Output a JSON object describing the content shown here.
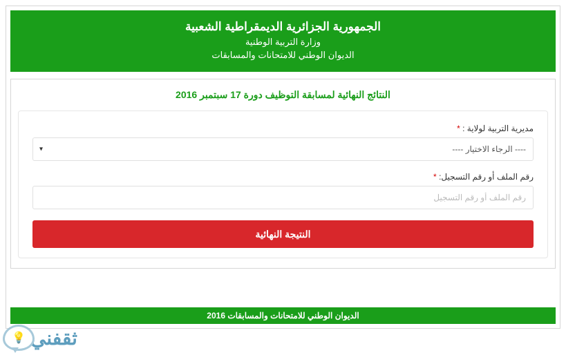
{
  "header": {
    "line1": "الجمهورية الجزائرية الديمقراطية الشعبية",
    "line2": "وزارة التربية الوطنية",
    "line3": "الديوان الوطني للامتحانات والمسابقات"
  },
  "content": {
    "title": "النتائج النهائية لمسابقة التوظيف دورة 17 سبتمبر 2016"
  },
  "form": {
    "wilaya_label": "مديرية التربية لولاية :",
    "wilaya_placeholder": "---- الرجاء الاختيار ----",
    "file_label": "رقم الملف أو رقم التسجيل:",
    "file_placeholder": "رقم الملف أو رقم التسجيل",
    "submit_label": "النتيجة النهائية",
    "required_mark": "*"
  },
  "footer": {
    "text": "الديوان الوطني للامتحانات والمسابقات 2016"
  },
  "watermark": {
    "text": "ثقفني"
  }
}
